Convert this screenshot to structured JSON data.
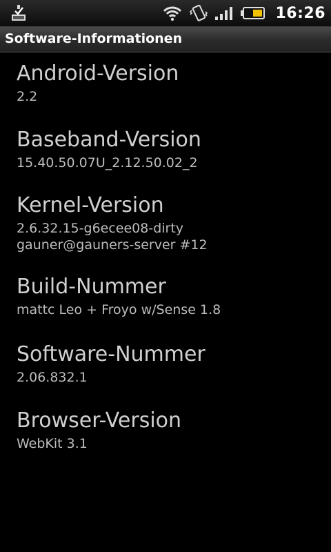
{
  "status_bar": {
    "left_icon": "download-complete-icon",
    "icons": [
      "wifi-icon",
      "vibrate-icon",
      "signal-icon",
      "battery-icon"
    ],
    "time": "16:26"
  },
  "title_bar": {
    "title": "Software-Informationen"
  },
  "items": [
    {
      "label": "Android-Version",
      "value": "2.2"
    },
    {
      "label": "Baseband-Version",
      "value": "15.40.50.07U_2.12.50.02_2"
    },
    {
      "label": "Kernel-Version",
      "value": "2.6.32.15-g6ecee08-dirty\ngauner@gauners-server #12"
    },
    {
      "label": "Build-Nummer",
      "value": "mattc Leo + Froyo w/Sense 1.8"
    },
    {
      "label": "Software-Nummer",
      "value": "2.06.832.1"
    },
    {
      "label": "Browser-Version",
      "value": "WebKit 3.1"
    }
  ],
  "colors": {
    "background": "#000000",
    "label": "#d0d0d0",
    "value": "#bdbdbd"
  }
}
